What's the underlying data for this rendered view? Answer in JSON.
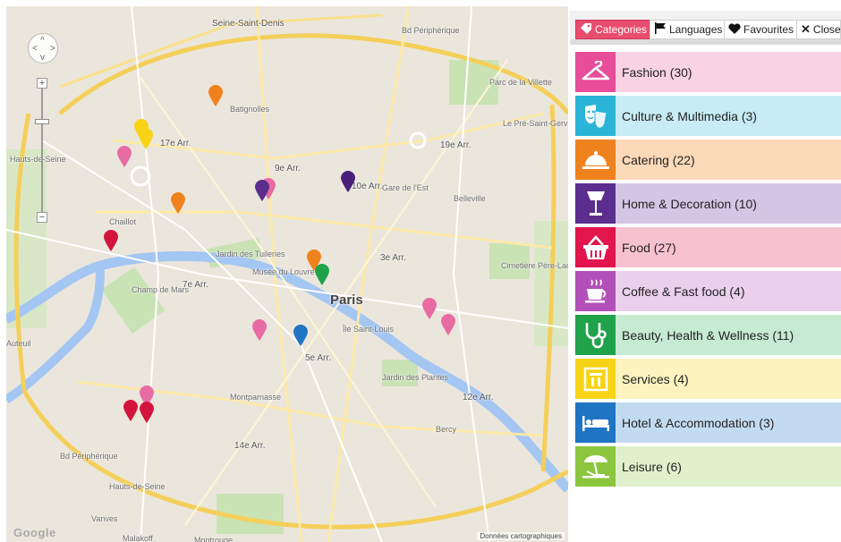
{
  "tabs": {
    "categories": "Categories",
    "languages": "Languages",
    "favourites": "Favourites",
    "close": "Close"
  },
  "categories": [
    {
      "label": "Fashion (30)",
      "icon": "hanger-icon",
      "color": "#e84d9a",
      "bg": "#f9d2e4"
    },
    {
      "label": "Culture & Multimedia (3)",
      "icon": "theater-masks-icon",
      "color": "#2ab5d8",
      "bg": "#c7ecf6"
    },
    {
      "label": "Catering (22)",
      "icon": "cloche-icon",
      "color": "#f0821e",
      "bg": "#fcd9b8"
    },
    {
      "label": "Home & Decoration (10)",
      "icon": "lamp-icon",
      "color": "#5b2d8e",
      "bg": "#d3c6e4"
    },
    {
      "label": "Food (27)",
      "icon": "basket-icon",
      "color": "#e2154d",
      "bg": "#f7c2cf"
    },
    {
      "label": "Coffee & Fast food (4)",
      "icon": "coffee-cup-icon",
      "color": "#b24fb8",
      "bg": "#ead0ec"
    },
    {
      "label": "Beauty, Health & Wellness (11)",
      "icon": "stethoscope-icon",
      "color": "#1fa24a",
      "bg": "#c6ead2"
    },
    {
      "label": "Services (4)",
      "icon": "atm-icon",
      "color": "#f7d316",
      "bg": "#fcf3bf"
    },
    {
      "label": "Hotel & Accommodation (3)",
      "icon": "bed-icon",
      "color": "#1f74c4",
      "bg": "#c3dbf0"
    },
    {
      "label": "Leisure (6)",
      "icon": "beach-umbrella-icon",
      "color": "#8bc63e",
      "bg": "#e1f0cc"
    }
  ],
  "map": {
    "city": "Paris",
    "arrondissements": [
      "17e Arr.",
      "9e Arr.",
      "10e Arr.",
      "19e Arr.",
      "3e Arr.",
      "7e Arr.",
      "5e Arr.",
      "12e Arr.",
      "14e Arr."
    ],
    "places": [
      "Seine-Saint-Denis",
      "Hauts-de-Seine",
      "Bd Périphérique",
      "Jardin des Tuileries",
      "Musée du Louvre",
      "Jardin des Plantes",
      "Champ de Mars",
      "Montparnasse",
      "Vanves",
      "Malakoff",
      "Montrouge",
      "Chaillot",
      "Cimetière Père-Lachaise",
      "Parc de la Villette",
      "Le Pré-Saint-Gervais",
      "Batignolles",
      "Gare de l'Est",
      "Bercy",
      "Belleville",
      "Île Saint-Louis",
      "Auteuil"
    ],
    "footer": "Données cartographiques",
    "logo": "Google"
  }
}
